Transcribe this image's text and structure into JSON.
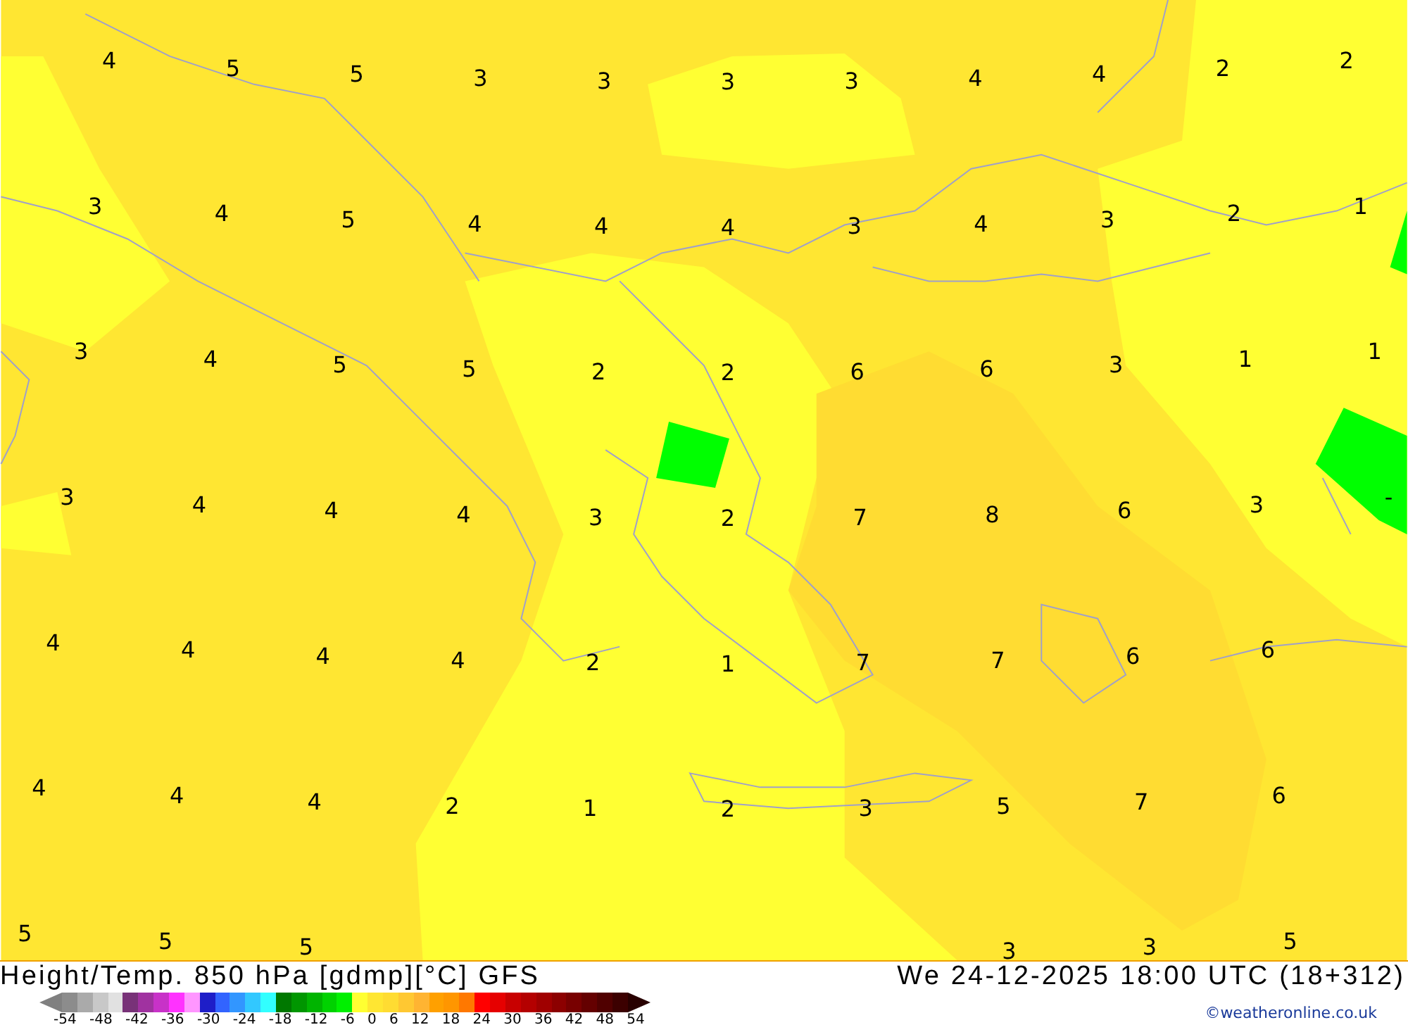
{
  "map": {
    "value_rows": [
      [
        "4",
        "5",
        "5",
        "3",
        "3",
        "3",
        "3",
        "4",
        "4",
        "2",
        "2"
      ],
      [
        "3",
        "4",
        "5",
        "4",
        "4",
        "4",
        "3",
        "4",
        "3",
        "2",
        "1"
      ],
      [
        "3",
        "4",
        "5",
        "5",
        "2",
        "2",
        "6",
        "6",
        "3",
        "1",
        "1"
      ],
      [
        "3",
        "4",
        "4",
        "4",
        "3",
        "2",
        "7",
        "8",
        "6",
        "3",
        "-"
      ],
      [
        "4",
        "4",
        "4",
        "4",
        "2",
        "1",
        "7",
        "7",
        "6",
        "6"
      ],
      [
        "4",
        "4",
        "4",
        "2",
        "1",
        "2",
        "3",
        "5",
        "7",
        "6"
      ],
      [
        "5",
        "5",
        "5",
        null,
        null,
        null,
        null,
        "3",
        "3",
        "5"
      ]
    ]
  },
  "title": "Height/Temp. 850 hPa [gdmp][°C] GFS",
  "valid_time": "We 24-12-2025 18:00 UTC (18+312)",
  "legend": {
    "swatches": [
      {
        "color": "#8c8c8c"
      },
      {
        "color": "#aaaaaa"
      },
      {
        "color": "#c8c8c8"
      },
      {
        "color": "#e1e1e1"
      },
      {
        "color": "#783278"
      },
      {
        "color": "#a032a0"
      },
      {
        "color": "#c832c8"
      },
      {
        "color": "#ff32ff"
      },
      {
        "color": "#ff96ff"
      },
      {
        "color": "#1e1ec8"
      },
      {
        "color": "#3264ff"
      },
      {
        "color": "#3296ff"
      },
      {
        "color": "#32c8ff"
      },
      {
        "color": "#32ffff"
      },
      {
        "color": "#007800"
      },
      {
        "color": "#009600"
      },
      {
        "color": "#00b400"
      },
      {
        "color": "#00d200"
      },
      {
        "color": "#00f000"
      },
      {
        "color": "#ffff32"
      },
      {
        "color": "#ffe632"
      },
      {
        "color": "#ffdc32"
      },
      {
        "color": "#ffc832"
      },
      {
        "color": "#ffb432"
      },
      {
        "color": "#ffa000"
      },
      {
        "color": "#ff9600"
      },
      {
        "color": "#ff7800"
      },
      {
        "color": "#ff0000"
      },
      {
        "color": "#e60000"
      },
      {
        "color": "#c80000"
      },
      {
        "color": "#b40000"
      },
      {
        "color": "#a00000"
      },
      {
        "color": "#8c0000"
      },
      {
        "color": "#780000"
      },
      {
        "color": "#640000"
      },
      {
        "color": "#500000"
      },
      {
        "color": "#3c0000"
      }
    ],
    "ticks": [
      "-54",
      "-48",
      "-42",
      "-36",
      "-30",
      "-24",
      "-18",
      "-12",
      "-6",
      "0",
      "6",
      "12",
      "18",
      "24",
      "30",
      "36",
      "42",
      "48",
      "54"
    ]
  },
  "credit": "©weatheronline.co.uk"
}
